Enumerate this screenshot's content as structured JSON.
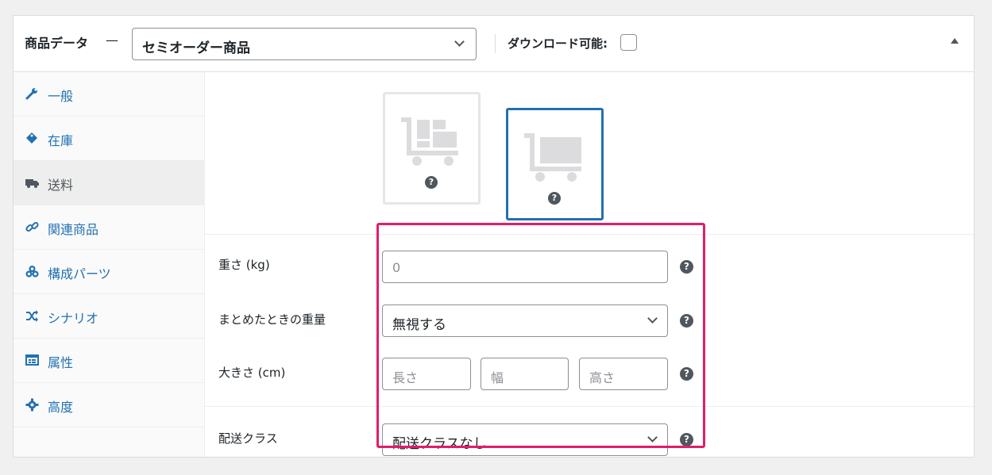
{
  "header": {
    "title": "商品データ",
    "dash": "—",
    "product_type": "セミオーダー商品",
    "downloadable_label": "ダウンロード可能:",
    "downloadable_checked": false
  },
  "sidebar": {
    "items": [
      {
        "label": "一般",
        "icon": "wrench-icon"
      },
      {
        "label": "在庫",
        "icon": "tag-icon"
      },
      {
        "label": "送料",
        "icon": "truck-icon",
        "active": true
      },
      {
        "label": "関連商品",
        "icon": "link-icon"
      },
      {
        "label": "構成パーツ",
        "icon": "cubes-icon"
      },
      {
        "label": "シナリオ",
        "icon": "shuffle-icon"
      },
      {
        "label": "属性",
        "icon": "list-card-icon"
      },
      {
        "label": "高度",
        "icon": "gear-icon"
      }
    ]
  },
  "shipping_mode": {
    "options": [
      {
        "icon": "cart-parts-icon",
        "help": "?",
        "selected": false
      },
      {
        "icon": "cart-box-icon",
        "help": "?",
        "selected": true
      }
    ]
  },
  "fields": {
    "weight": {
      "label": "重さ (kg)",
      "placeholder": "0",
      "help": "?"
    },
    "aggregate_weight": {
      "label": "まとめたときの重量",
      "value": "無視する",
      "help": "?"
    },
    "dimensions": {
      "label": "大きさ (cm)",
      "length_placeholder": "長さ",
      "width_placeholder": "幅",
      "height_placeholder": "高さ",
      "help": "?"
    },
    "shipping_class": {
      "label": "配送クラス",
      "value": "配送クラスなし",
      "help": "?"
    }
  },
  "colors": {
    "accent": "#2271b1",
    "highlight": "#e11d6c",
    "text": "#1d2327"
  }
}
